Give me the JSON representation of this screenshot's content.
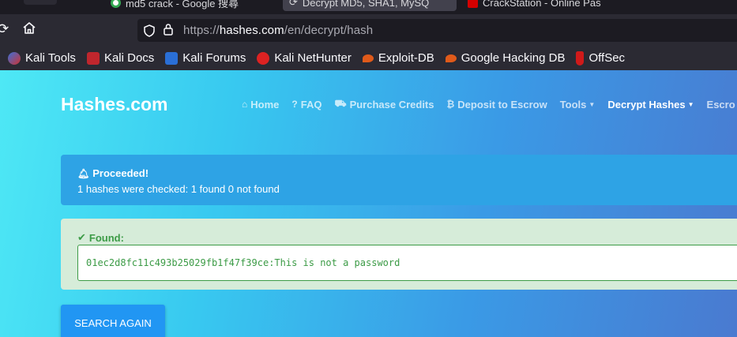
{
  "browser": {
    "tabs": [
      {
        "label": "md5 crack - Google 搜尋"
      },
      {
        "label": "Decrypt MD5, SHA1, MySQ"
      },
      {
        "label": "CrackStation - Online Pas"
      }
    ],
    "url_prefix": "https://",
    "url_domain": "hashes.com",
    "url_path": "/en/decrypt/hash",
    "bookmarks": [
      {
        "label": "Kali Tools",
        "icon": "kali-icon"
      },
      {
        "label": "Kali Docs",
        "icon": "kali-docs-icon"
      },
      {
        "label": "Kali Forums",
        "icon": "kali-forums-icon"
      },
      {
        "label": "Kali NetHunter",
        "icon": "nethunter-icon"
      },
      {
        "label": "Exploit-DB",
        "icon": "exploit-db-icon"
      },
      {
        "label": "Google Hacking DB",
        "icon": "ghdb-icon"
      },
      {
        "label": "OffSec",
        "icon": "offsec-icon"
      }
    ]
  },
  "site": {
    "brand": "Hashes.com",
    "menu": {
      "home": "Home",
      "faq": "FAQ",
      "purchase": "Purchase Credits",
      "escrow_deposit": "Deposit to Escrow",
      "tools": "Tools",
      "decrypt": "Decrypt Hashes",
      "escrow": "Escro"
    }
  },
  "info_alert": {
    "title": "Proceeded!",
    "message": "1 hashes were checked: 1 found 0 not found"
  },
  "success_alert": {
    "title": "Found:",
    "result": "01ec2d8fc11c493b25029fb1f47f39ce:This is not a password"
  },
  "search_again_label": "SEARCH AGAIN",
  "colors": {
    "info": "#2ea3e5",
    "success_bg": "#d6ecd9",
    "success_text": "#3c9b46",
    "button": "#2196f3"
  }
}
